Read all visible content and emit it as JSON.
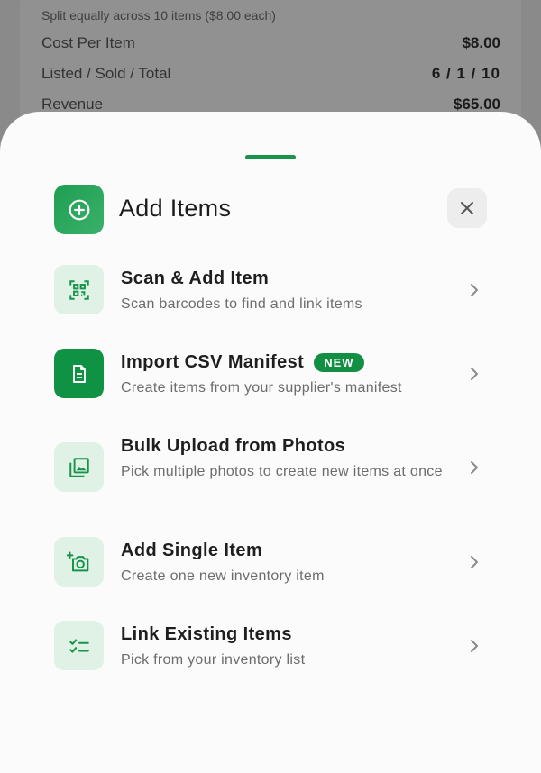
{
  "background": {
    "note": "Split equally across 10 items ($8.00 each)",
    "rows": [
      {
        "label": "Cost Per Item",
        "value": "$8.00"
      },
      {
        "label": "Listed / Sold / Total",
        "value": "6 / 1 / 10"
      },
      {
        "label": "Revenue",
        "value": "$65.00"
      }
    ]
  },
  "sheet": {
    "title": "Add Items",
    "header_icon": "plus-circle-icon",
    "close_icon": "close-icon",
    "accent_color": "#138f44",
    "items": [
      {
        "title": "Scan & Add Item",
        "subtitle": "Scan barcodes to find and link items",
        "icon": "qr-scan-icon"
      },
      {
        "title": "Import CSV Manifest",
        "badge": "NEW",
        "subtitle": "Create items from your supplier's manifest",
        "icon": "document-icon"
      },
      {
        "title": "Bulk Upload from Photos",
        "subtitle": "Pick multiple photos to create new items at once",
        "icon": "photo-library-icon"
      },
      {
        "title": "Add Single Item",
        "subtitle": "Create one new inventory item",
        "icon": "camera-add-icon"
      },
      {
        "title": "Link Existing Items",
        "subtitle": "Pick from your inventory list",
        "icon": "checklist-icon"
      }
    ]
  }
}
